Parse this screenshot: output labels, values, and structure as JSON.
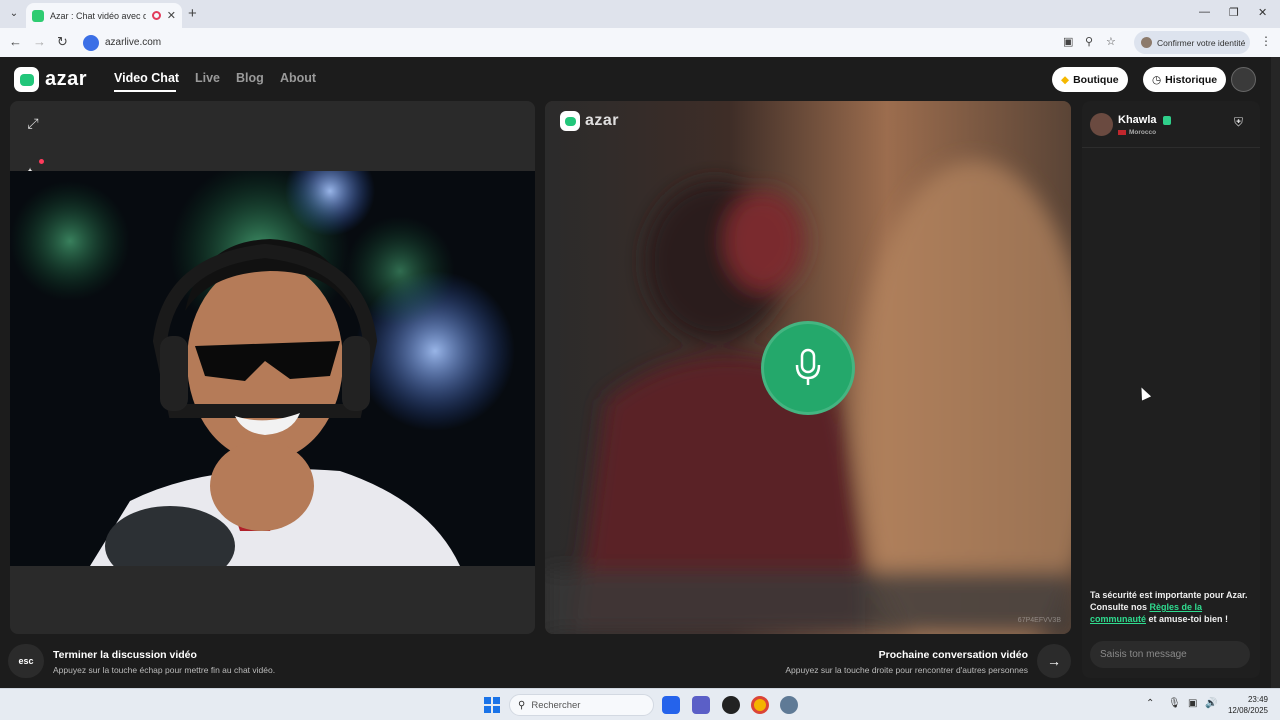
{
  "browser": {
    "tab_title": "Azar : Chat vidéo avec de n",
    "url": "azarlive.com",
    "confirm_identity": "Confirmer votre identité"
  },
  "site": {
    "logo": "azar",
    "nav": [
      "Video Chat",
      "Live",
      "Blog",
      "About"
    ],
    "boutique": "Boutique",
    "historique": "Historique"
  },
  "partner": {
    "name": "Khawla",
    "country": "Morocco",
    "watermark": "67P4EFVV3B"
  },
  "chat": {
    "safety_prefix": "Ta sécurité est importante pour Azar. Consulte nos ",
    "safety_link": "Règles de la communauté",
    "safety_suffix": " et amuse-toi bien !",
    "input_placeholder": "Saisis ton message"
  },
  "actions": {
    "esc_key": "esc",
    "end_title": "Terminer la discussion vidéo",
    "end_sub": "Appuyez sur la touche échap pour mettre fin au chat vidéo.",
    "next_title": "Prochaine conversation vidéo",
    "next_sub": "Appuyez sur la touche droite pour rencontrer d'autres personnes"
  },
  "taskbar": {
    "search": "Rechercher",
    "time": "23:49",
    "date": "12/08/2025"
  },
  "colors": {
    "brand_green": "#22c67a",
    "mic_green": "#24a86b",
    "link_green": "#2fdc8f"
  }
}
